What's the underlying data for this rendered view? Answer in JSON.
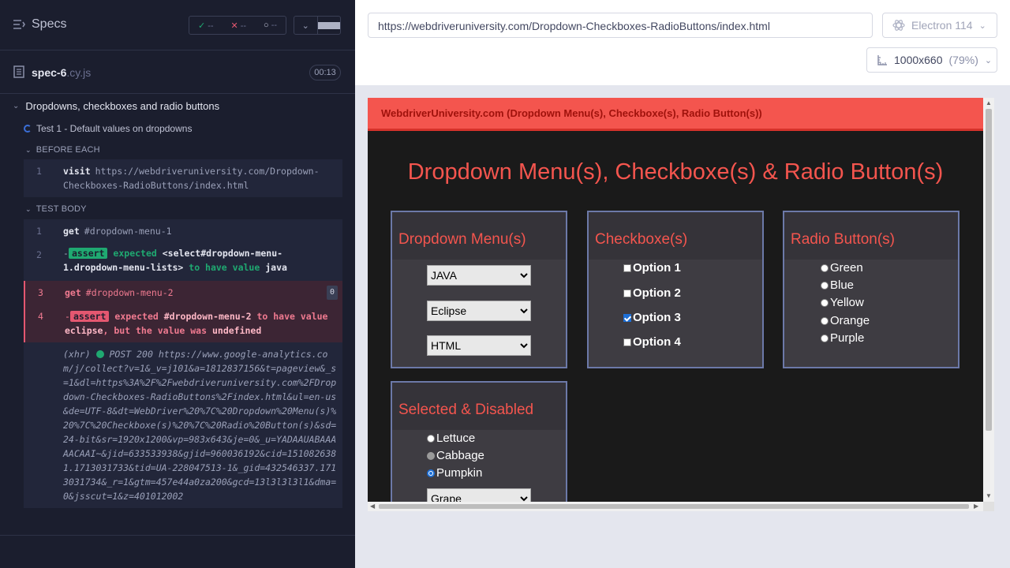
{
  "reporter": {
    "specs_label": "Specs",
    "stats": {
      "passed": "--",
      "failed": "--",
      "pending": "--"
    },
    "spec_file": {
      "name": "spec-6",
      "ext": ".cy.js",
      "duration": "00:13"
    },
    "suite_title": "Dropdowns, checkboxes and radio buttons",
    "test_title": "Test 1 - Default values on dropdowns",
    "before_each_label": "BEFORE EACH",
    "test_body_label": "TEST BODY",
    "before_each": [
      {
        "num": "1",
        "name": "visit",
        "message": "https://webdriveruniversity.com/Dropdown-Checkboxes-RadioButtons/index.html"
      }
    ],
    "body": [
      {
        "num": "1",
        "name": "get",
        "message": "#dropdown-menu-1"
      },
      {
        "num": "2",
        "tag": "assert",
        "dash": "-",
        "expected": "expected",
        "subject": "<select#dropdown-menu-1.dropdown-menu-lists>",
        "to_have": "to have value",
        "value": "java"
      },
      {
        "num": "3",
        "name": "get",
        "message": "#dropdown-menu-2",
        "badge": "0"
      },
      {
        "num": "4",
        "tag": "assert",
        "dash": "-",
        "expected": "expected",
        "subject": "#dropdown-menu-2",
        "to_have": "to have value",
        "value": "eclipse",
        "but": ", but the value was",
        "actual": "undefined"
      }
    ],
    "xhr": {
      "label": "(xhr)",
      "method_status": "POST 200",
      "url": "https://www.google-analytics.com/j/collect?v=1&_v=j101&a=1812837156&t=pageview&_s=1&dl=https%3A%2F%2Fwebdriveruniversity.com%2FDropdown-Checkboxes-RadioButtons%2Findex.html&ul=en-us&de=UTF-8&dt=WebDriver%20%7C%20Dropdown%20Menu(s)%20%7C%20Checkboxe(s)%20%7C%20Radio%20Button(s)&sd=24-bit&sr=1920x1200&vp=983x643&je=0&_u=YADAAUABAAAAACAAI~&jid=633533938&gjid=960036192&cid=1510826381.1713031733&tid=UA-228047513-1&_gid=432546337.1713031734&_r=1&gtm=457e44a0za200&gcd=13l3l3l3l1&dma=0&jsscut=1&z=401012002"
    }
  },
  "aut": {
    "url": "https://webdriveruniversity.com/Dropdown-Checkboxes-RadioButtons/index.html",
    "browser": "Electron 114",
    "viewport": "1000x660",
    "zoom": "(79%)",
    "site": {
      "nav_title": "WebdriverUniversity.com (Dropdown Menu(s), Checkboxe(s), Radio Button(s))",
      "heading": "Dropdown Menu(s), Checkboxe(s) & Radio Button(s)",
      "dropdown_panel": {
        "title": "Dropdown Menu(s)",
        "selects": [
          "JAVA",
          "Eclipse",
          "HTML"
        ]
      },
      "checkbox_panel": {
        "title": "Checkboxe(s)",
        "options": [
          "Option 1",
          "Option 2",
          "Option 3",
          "Option 4"
        ],
        "checked_index": 2
      },
      "radio_panel": {
        "title": "Radio Button(s)",
        "options": [
          "Green",
          "Blue",
          "Yellow",
          "Orange",
          "Purple"
        ]
      },
      "selected_disabled_panel": {
        "title": "Selected & Disabled",
        "options": [
          "Lettuce",
          "Cabbage",
          "Pumpkin"
        ],
        "disabled_index": 1,
        "selected_index": 2,
        "select_value": "Grape"
      }
    }
  }
}
